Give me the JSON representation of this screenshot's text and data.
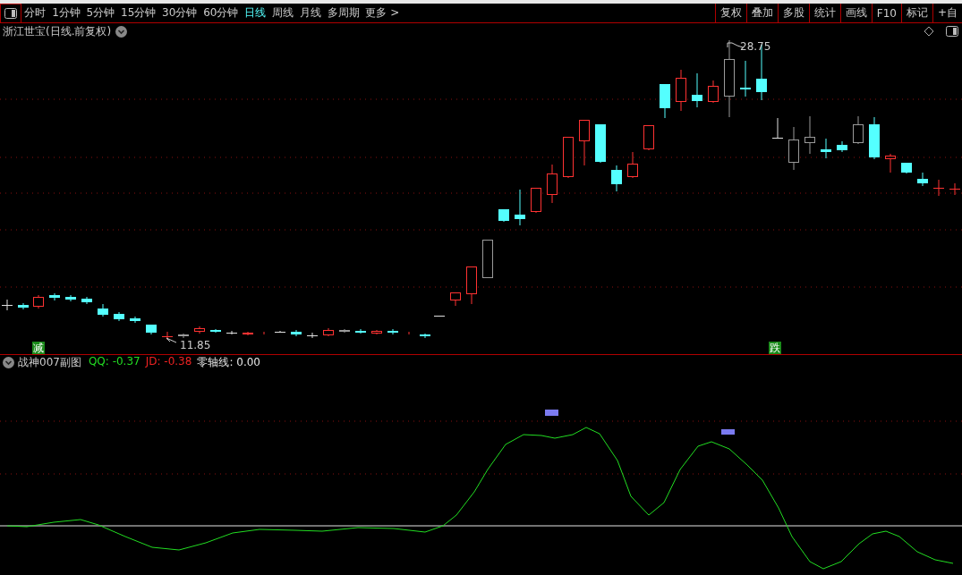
{
  "toolbar": {
    "periods": [
      {
        "label": "分时",
        "selected": false
      },
      {
        "label": "1分钟",
        "selected": false
      },
      {
        "label": "5分钟",
        "selected": false
      },
      {
        "label": "15分钟",
        "selected": false
      },
      {
        "label": "30分钟",
        "selected": false
      },
      {
        "label": "60分钟",
        "selected": false
      },
      {
        "label": "日线",
        "selected": true
      },
      {
        "label": "周线",
        "selected": false
      },
      {
        "label": "月线",
        "selected": false
      },
      {
        "label": "多周期",
        "selected": false
      },
      {
        "label": "更多 >",
        "selected": false
      }
    ],
    "buttons": [
      "复权",
      "叠加",
      "多股",
      "统计",
      "画线",
      "F10",
      "标记",
      "+自"
    ]
  },
  "chart": {
    "title": "浙江世宝(日线.前复权)",
    "high_label": "28.75",
    "low_label": "11.85",
    "signals": [
      {
        "text": "减"
      },
      {
        "text": "跌"
      }
    ]
  },
  "indicator": {
    "name": "战神007副图",
    "legend": [
      {
        "text": "QQ: -0.37",
        "color": "#22dd22"
      },
      {
        "text": "JD: -0.38",
        "color": "#ee2222"
      },
      {
        "text": "零轴线: 0.00",
        "color": "#e6e6e6"
      }
    ]
  }
}
